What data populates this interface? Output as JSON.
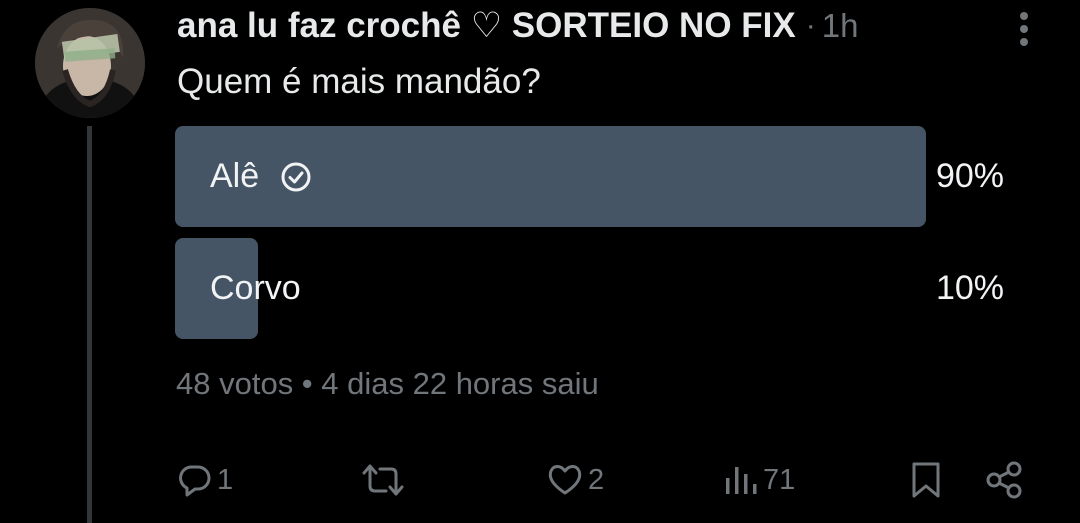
{
  "tweet": {
    "author": "ana lu faz crochê ♡ SORTEIO NO FIX",
    "separator": "·",
    "time": "1h",
    "text": "Quem é mais mandão?",
    "avatar_icon": "profile-photo"
  },
  "poll": {
    "options": [
      {
        "label": "Alê",
        "percent": 90,
        "percent_label": "90%",
        "winner": true
      },
      {
        "label": "Corvo",
        "percent": 10,
        "percent_label": "10%",
        "winner": false
      }
    ],
    "meta": "48 votos • 4 dias 22 horas saiu",
    "bar_color": "#465565"
  },
  "actions": {
    "reply_count": "1",
    "retweet_count": "",
    "like_count": "2",
    "views_count": "71"
  },
  "colors": {
    "background": "#000000",
    "text": "#e7e9ea",
    "muted": "#71767b"
  }
}
